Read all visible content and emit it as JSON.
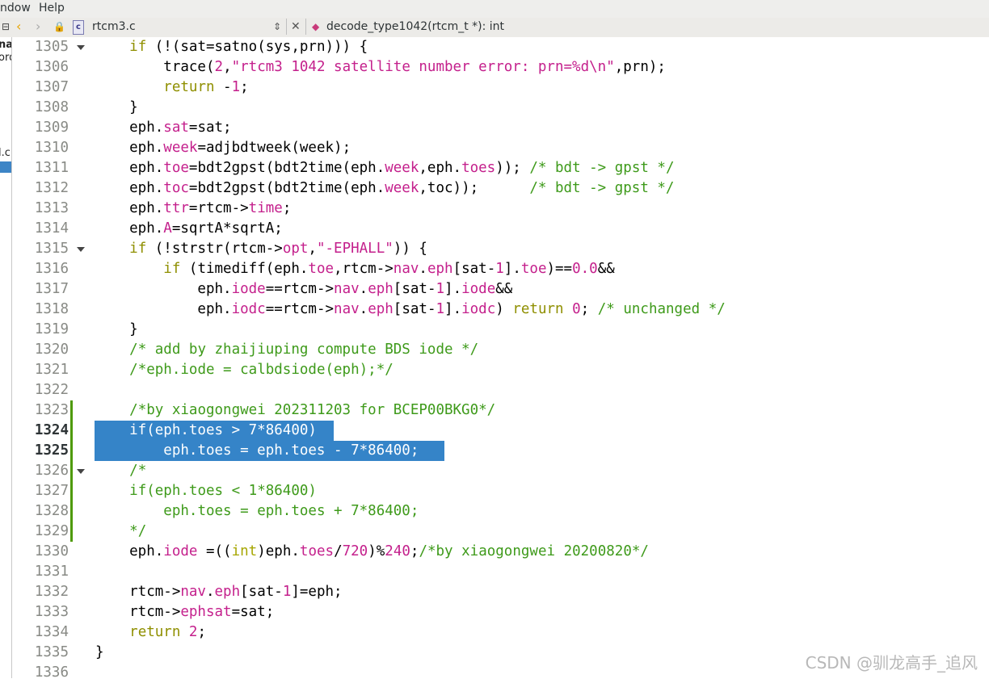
{
  "menu": {
    "items": [
      "ndow",
      "Help"
    ]
  },
  "filebar": {
    "filename": "rtcm3.c",
    "function": "decode_type1042(rtcm_t *): int"
  },
  "sidepanel": {
    "fragments": [
      "na",
      "ord",
      "l.c"
    ]
  },
  "editor": {
    "lines": [
      {
        "n": "1305",
        "html": "    <span class=\"k\">if</span> (!(sat=satno(sys,prn))) {",
        "fold": true
      },
      {
        "n": "1306",
        "html": "        trace(<span class=\"n\">2</span>,<span class=\"s\">\"rtcm3 1042 satellite number error: prn=%d\\n\"</span>,prn);"
      },
      {
        "n": "1307",
        "html": "        <span class=\"k\">return</span> -<span class=\"n\">1</span>;"
      },
      {
        "n": "1308",
        "html": "    }"
      },
      {
        "n": "1309",
        "html": "    eph.<span class=\"s\">sat</span>=sat;"
      },
      {
        "n": "1310",
        "html": "    eph.<span class=\"s\">week</span>=adjbdtweek(week);"
      },
      {
        "n": "1311",
        "html": "    eph.<span class=\"s\">toe</span>=bdt2gpst(bdt2time(eph.<span class=\"s\">week</span>,eph.<span class=\"s\">toes</span>)); <span class=\"c\">/* bdt -> gpst */</span>"
      },
      {
        "n": "1312",
        "html": "    eph.<span class=\"s\">toc</span>=bdt2gpst(bdt2time(eph.<span class=\"s\">week</span>,toc));      <span class=\"c\">/* bdt -> gpst */</span>"
      },
      {
        "n": "1313",
        "html": "    eph.<span class=\"s\">ttr</span>=rtcm-><span class=\"s\">time</span>;"
      },
      {
        "n": "1314",
        "html": "    eph.<span class=\"s\">A</span>=sqrtA*sqrtA;"
      },
      {
        "n": "1315",
        "html": "    <span class=\"k\">if</span> (!strstr(rtcm-><span class=\"s\">opt</span>,<span class=\"s\">\"-EPHALL\"</span>)) {",
        "fold": true
      },
      {
        "n": "1316",
        "html": "        <span class=\"k\">if</span> (timediff(eph.<span class=\"s\">toe</span>,rtcm-><span class=\"s\">nav</span>.<span class=\"s\">eph</span>[sat-<span class=\"n\">1</span>].<span class=\"s\">toe</span>)==<span class=\"n\">0.0</span>&amp;&amp;"
      },
      {
        "n": "1317",
        "html": "            eph.<span class=\"s\">iode</span>==rtcm-><span class=\"s\">nav</span>.<span class=\"s\">eph</span>[sat-<span class=\"n\">1</span>].<span class=\"s\">iode</span>&amp;&amp;"
      },
      {
        "n": "1318",
        "html": "            eph.<span class=\"s\">iodc</span>==rtcm-><span class=\"s\">nav</span>.<span class=\"s\">eph</span>[sat-<span class=\"n\">1</span>].<span class=\"s\">iodc</span>) <span class=\"k\">return</span> <span class=\"n\">0</span>; <span class=\"c\">/* unchanged */</span>"
      },
      {
        "n": "1319",
        "html": "    }"
      },
      {
        "n": "1320",
        "html": "    <span class=\"c\">/* add by zhaijiuping compute BDS iode */</span>"
      },
      {
        "n": "1321",
        "html": "    <span class=\"c\">/*eph.iode = calbdsiode(eph);*/</span>"
      },
      {
        "n": "1322",
        "html": ""
      },
      {
        "n": "1323",
        "html": "    <span class=\"c\">/*by xiaogongwei 202311203 for BCEP00BKG0*/</span>",
        "changed": true
      },
      {
        "n": "1324",
        "html": "    if(eph.toes &gt; 7*86400)",
        "selected": true,
        "selw": 296,
        "current": true,
        "changed": true
      },
      {
        "n": "1325",
        "html": "        eph.toes = eph.toes - 7*86400;",
        "selected": true,
        "selw": 433,
        "current": true,
        "changed": true
      },
      {
        "n": "1326",
        "html": "    <span class=\"c\">/*</span>",
        "fold": true,
        "changed": true
      },
      {
        "n": "1327",
        "html": "    <span class=\"c\">if(eph.toes &lt; 1*86400)</span>",
        "changed": true
      },
      {
        "n": "1328",
        "html": "    <span class=\"c\">    eph.toes = eph.toes + 7*86400;</span>",
        "changed": true
      },
      {
        "n": "1329",
        "html": "    <span class=\"c\">*/</span>",
        "changed": true
      },
      {
        "n": "1330",
        "html": "    eph.<span class=\"s\">iode</span> =((<span class=\"t\">int</span>)eph.<span class=\"s\">toes</span>/<span class=\"n\">720</span>)%<span class=\"n\">240</span>;<span class=\"c\">/*by xiaogongwei 20200820*/</span>"
      },
      {
        "n": "1331",
        "html": ""
      },
      {
        "n": "1332",
        "html": "    rtcm-><span class=\"s\">nav</span>.<span class=\"s\">eph</span>[sat-<span class=\"n\">1</span>]=eph;"
      },
      {
        "n": "1333",
        "html": "    rtcm-><span class=\"s\">ephsat</span>=sat;"
      },
      {
        "n": "1334",
        "html": "    <span class=\"k\">return</span> <span class=\"n\">2</span>;"
      },
      {
        "n": "1335",
        "html": "}"
      },
      {
        "n": "1336",
        "html": ""
      }
    ]
  },
  "watermark": "CSDN @驯龙高手_追风"
}
